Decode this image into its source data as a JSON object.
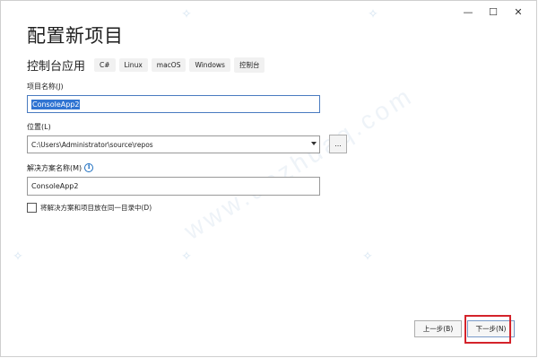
{
  "window": {
    "controls": {
      "minimize": "—",
      "maximize": "☐",
      "close": "✕"
    }
  },
  "page_title": "配置新项目",
  "template": {
    "name": "控制台应用",
    "tags": [
      "C#",
      "Linux",
      "macOS",
      "Windows",
      "控制台"
    ]
  },
  "project_name": {
    "label": "项目名称(J)",
    "value": "ConsoleApp2"
  },
  "location": {
    "label": "位置(L)",
    "value": "C:\\Users\\Administrator\\source\\repos",
    "browse_label": "..."
  },
  "solution_name": {
    "label": "解决方案名称(M)",
    "value": "ConsoleApp2"
  },
  "same_directory": {
    "label": "将解决方案和项目放在同一目录中(D)",
    "checked": false
  },
  "buttons": {
    "back": "上一步(B)",
    "next": "下一步(N)"
  },
  "colors": {
    "accent": "#3074d2",
    "highlight_border": "#d4232b",
    "info_icon": "#1e6fc0"
  },
  "icons": {
    "info": "info-icon",
    "dropdown": "chevron-down-icon",
    "sparkle": "sparkle-icon"
  }
}
